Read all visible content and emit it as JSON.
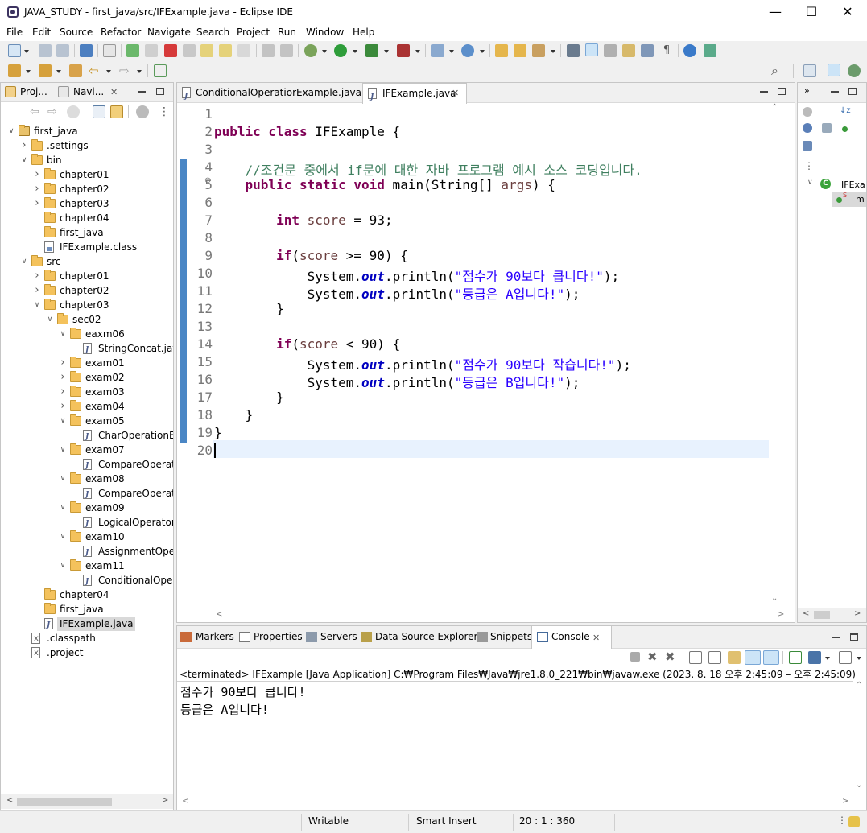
{
  "window": {
    "title": "JAVA_STUDY - first_java/src/IFExample.java - Eclipse IDE",
    "minimize": "—",
    "maximize": "☐",
    "close": "✕"
  },
  "menu": [
    "File",
    "Edit",
    "Source",
    "Refactor",
    "Navigate",
    "Search",
    "Project",
    "Run",
    "Window",
    "Help"
  ],
  "left_panel": {
    "tabs": [
      {
        "label": "Proj..."
      },
      {
        "label": "Navi..."
      }
    ],
    "tree": [
      {
        "label": "first_java",
        "icon": "project-icon",
        "indent": 0,
        "twisty": "open"
      },
      {
        "label": ".settings",
        "icon": "folder-icon",
        "indent": 1,
        "twisty": "closed"
      },
      {
        "label": "bin",
        "icon": "folder-icon",
        "indent": 1,
        "twisty": "open"
      },
      {
        "label": "chapter01",
        "icon": "folder-icon",
        "indent": 2,
        "twisty": "closed"
      },
      {
        "label": "chapter02",
        "icon": "folder-icon",
        "indent": 2,
        "twisty": "closed"
      },
      {
        "label": "chapter03",
        "icon": "folder-icon",
        "indent": 2,
        "twisty": "closed"
      },
      {
        "label": "chapter04",
        "icon": "folder-icon",
        "indent": 2,
        "twisty": "none"
      },
      {
        "label": "first_java",
        "icon": "folder-icon",
        "indent": 2,
        "twisty": "none"
      },
      {
        "label": "IFExample.class",
        "icon": "class-file-icon",
        "indent": 2,
        "twisty": "none"
      },
      {
        "label": "src",
        "icon": "folder-icon",
        "indent": 1,
        "twisty": "open"
      },
      {
        "label": "chapter01",
        "icon": "folder-icon",
        "indent": 2,
        "twisty": "closed"
      },
      {
        "label": "chapter02",
        "icon": "folder-icon",
        "indent": 2,
        "twisty": "closed"
      },
      {
        "label": "chapter03",
        "icon": "folder-icon",
        "indent": 2,
        "twisty": "open"
      },
      {
        "label": "sec02",
        "icon": "folder-icon",
        "indent": 3,
        "twisty": "open"
      },
      {
        "label": "eaxm06",
        "icon": "folder-icon",
        "indent": 4,
        "twisty": "open"
      },
      {
        "label": "StringConcat.jav",
        "icon": "java-file-icon",
        "indent": 5,
        "twisty": "none"
      },
      {
        "label": "exam01",
        "icon": "folder-icon",
        "indent": 4,
        "twisty": "closed"
      },
      {
        "label": "exam02",
        "icon": "folder-icon",
        "indent": 4,
        "twisty": "closed"
      },
      {
        "label": "exam03",
        "icon": "folder-icon",
        "indent": 4,
        "twisty": "closed"
      },
      {
        "label": "exam04",
        "icon": "folder-icon",
        "indent": 4,
        "twisty": "closed"
      },
      {
        "label": "exam05",
        "icon": "folder-icon",
        "indent": 4,
        "twisty": "open"
      },
      {
        "label": "CharOperationEx",
        "icon": "java-file-icon",
        "indent": 5,
        "twisty": "none"
      },
      {
        "label": "exam07",
        "icon": "folder-icon",
        "indent": 4,
        "twisty": "open"
      },
      {
        "label": "CompareOperato",
        "icon": "java-file-icon",
        "indent": 5,
        "twisty": "none"
      },
      {
        "label": "exam08",
        "icon": "folder-icon",
        "indent": 4,
        "twisty": "open"
      },
      {
        "label": "CompareOperato",
        "icon": "java-file-icon",
        "indent": 5,
        "twisty": "none"
      },
      {
        "label": "exam09",
        "icon": "folder-icon",
        "indent": 4,
        "twisty": "open"
      },
      {
        "label": "LogicalOperator.",
        "icon": "java-file-icon",
        "indent": 5,
        "twisty": "none"
      },
      {
        "label": "exam10",
        "icon": "folder-icon",
        "indent": 4,
        "twisty": "open"
      },
      {
        "label": "AssignmentOper",
        "icon": "java-file-icon",
        "indent": 5,
        "twisty": "none"
      },
      {
        "label": "exam11",
        "icon": "folder-icon",
        "indent": 4,
        "twisty": "open"
      },
      {
        "label": "ConditionalOper",
        "icon": "java-file-icon",
        "indent": 5,
        "twisty": "none"
      },
      {
        "label": "chapter04",
        "icon": "folder-icon",
        "indent": 2,
        "twisty": "none"
      },
      {
        "label": "first_java",
        "icon": "folder-icon",
        "indent": 2,
        "twisty": "none"
      },
      {
        "label": "IFExample.java",
        "icon": "java-file-icon",
        "indent": 2,
        "twisty": "none",
        "selected": true
      },
      {
        "label": ".classpath",
        "icon": "xml-file-icon",
        "indent": 1,
        "twisty": "none"
      },
      {
        "label": ".project",
        "icon": "xml-file-icon",
        "indent": 1,
        "twisty": "none"
      }
    ]
  },
  "editor": {
    "tabs": [
      {
        "label": "ConditionalOperatiorExample.java",
        "active": false
      },
      {
        "label": "IFExample.java",
        "active": true
      }
    ],
    "line_numbers": [
      "1",
      "2",
      "3",
      "4",
      "5",
      "6",
      "7",
      "8",
      "9",
      "10",
      "11",
      "12",
      "13",
      "14",
      "15",
      "16",
      "17",
      "18",
      "19",
      "20"
    ],
    "code": {
      "l2_kw": "public class",
      "l2_rest": " IFExample {",
      "l4_comment": "//조건문 중에서 if문에 대한 자바 프로그램 예시 소스 코딩입니다.",
      "l5_kw": "public static void",
      "l5_rest_a": " main(String[] ",
      "l5_var": "args",
      "l5_rest_b": ") {",
      "l7_kw": "int",
      "l7_var": "score",
      "l7_rest": " = 93;",
      "l9_kw": "if",
      "l9_a": "(",
      "l9_var": "score",
      "l9_b": " >= 90) {",
      "l10_a": "System.",
      "l10_fld": "out",
      "l10_b": ".println(",
      "l10_str": "\"점수가 90보다 큽니다!\"",
      "l10_c": ");",
      "l11_a": "System.",
      "l11_fld": "out",
      "l11_b": ".println(",
      "l11_str": "\"등급은 A입니다!\"",
      "l11_c": ");",
      "l12": "}",
      "l14_kw": "if",
      "l14_a": "(",
      "l14_var": "score",
      "l14_b": " < 90) {",
      "l15_a": "System.",
      "l15_fld": "out",
      "l15_b": ".println(",
      "l15_str": "\"점수가 90보다 작습니다!\"",
      "l15_c": ");",
      "l16_a": "System.",
      "l16_fld": "out",
      "l16_b": ".println(",
      "l16_str": "\"등급은 B입니다!\"",
      "l16_c": ");",
      "l17": "}",
      "l18": "}",
      "l19": "}"
    }
  },
  "outline_panel": {
    "class_label": "IFExa",
    "method_label": "m"
  },
  "console": {
    "tabs": [
      "Markers",
      "Properties",
      "Servers",
      "Data Source Explorer",
      "Snippets",
      "Console"
    ],
    "status": "<terminated> IFExample [Java Application] C:₩Program Files₩Java₩jre1.8.0_221₩bin₩javaw.exe  (2023. 8. 18 오후 2:45:09 – 오후 2:45:09)",
    "output": [
      "점수가 90보다 큽니다!",
      "등급은 A입니다!"
    ]
  },
  "statusbar": {
    "writable": "Writable",
    "insert_mode": "Smart Insert",
    "position": "20 : 1 : 360"
  },
  "colors": {
    "keyword": "#7f0055",
    "comment": "#3f7f5f",
    "string": "#2a00ff",
    "field": "#0000c0",
    "local_var": "#6a3e3e",
    "current_line": "#e8f2fe",
    "selection": "#cce8ff"
  }
}
